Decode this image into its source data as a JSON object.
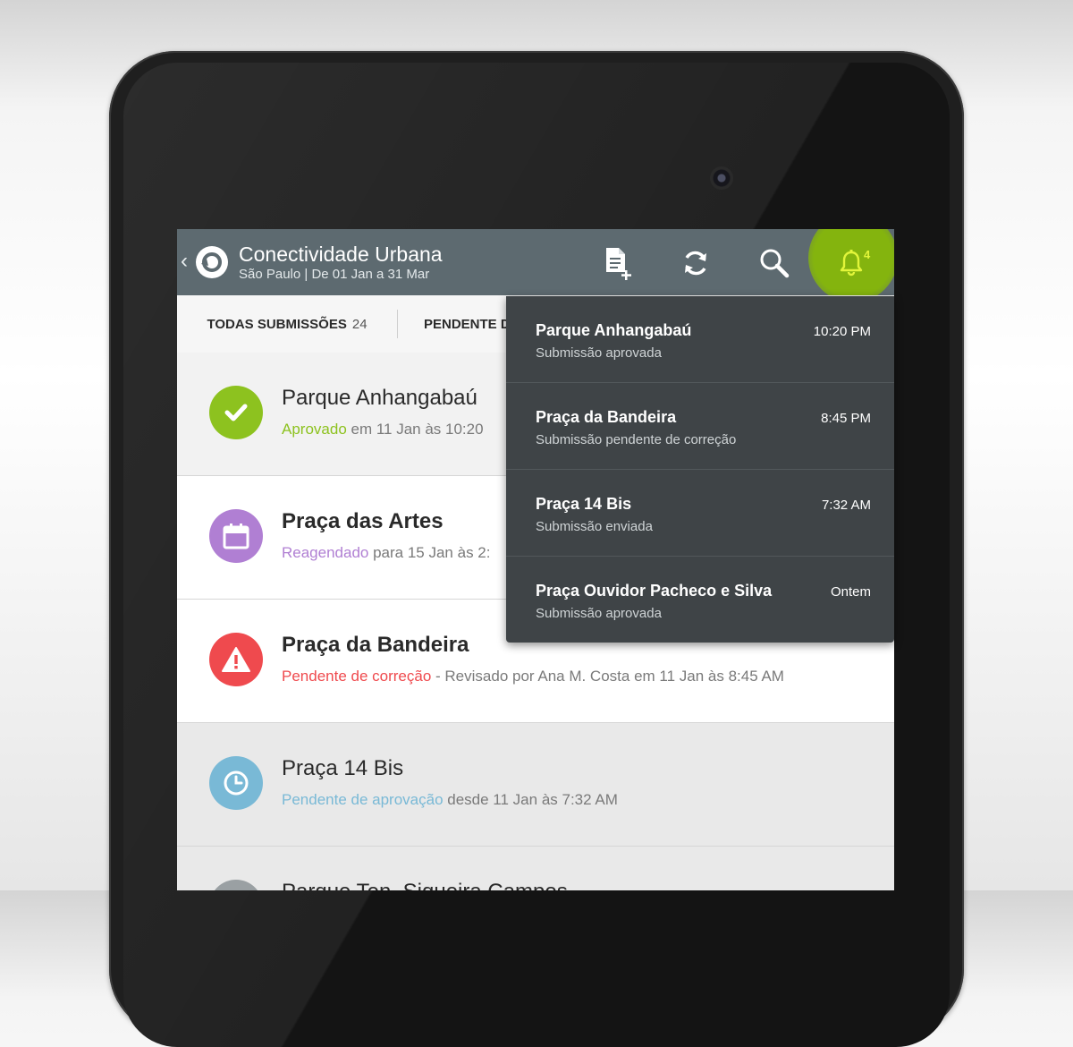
{
  "colors": {
    "appbar": "#5d6a70",
    "approved": "#8dc21f",
    "rescheduled": "#b07fd3",
    "correction": "#ef4a4e",
    "pending_approval": "#79b9d6",
    "notification_accent": "#84b40e",
    "panel": "#3f4447"
  },
  "appbar": {
    "back_icon": "chevron-left-icon",
    "logo_icon": "refresh-circle-logo",
    "title": "Conectividade Urbana",
    "subtitle": "São Paulo | De 01 Jan a 31 Mar",
    "actions": {
      "new_submission_icon": "file-add-icon",
      "sync_icon": "sync-icon",
      "search_icon": "search-icon",
      "notifications_icon": "bell-icon",
      "notifications_count": "4"
    }
  },
  "tabs": [
    {
      "label": "TODAS SUBMISSÕES",
      "count": "24",
      "selected": true
    },
    {
      "label": "PENDENTE D",
      "count": "",
      "selected": false
    }
  ],
  "submissions": [
    {
      "title": "Parque Anhangabaú",
      "status": "Aprovado",
      "detail": " em 11 Jan às 10:20",
      "icon": "check-icon",
      "status_color": "#8dc21f",
      "bold": false
    },
    {
      "title": "Praça das Artes",
      "status": "Reagendado",
      "detail": " para 15 Jan às 2:",
      "icon": "calendar-icon",
      "status_color": "#b07fd3",
      "bold": true
    },
    {
      "title": "Praça da Bandeira",
      "status": "Pendente de correção",
      "detail": " - Revisado por Ana M. Costa em 11 Jan às 8:45 AM",
      "icon": "warning-icon",
      "status_color": "#ef4a4e",
      "bold": true
    },
    {
      "title": "Praça 14 Bis",
      "status": "Pendente de aprovação",
      "detail": " desde 11 Jan às 7:32 AM",
      "icon": "clock-icon",
      "status_color": "#79b9d6",
      "bold": false
    },
    {
      "title": "Parque Ten. Siqueira Campos",
      "status": "",
      "detail": "",
      "icon": "status-icon",
      "status_color": "#9aa0a3",
      "bold": false
    }
  ],
  "notifications": [
    {
      "title": "Parque Anhangabaú",
      "subtitle": "Submissão aprovada",
      "time": "10:20 PM"
    },
    {
      "title": "Praça da Bandeira",
      "subtitle": "Submissão pendente de correção",
      "time": "8:45 PM"
    },
    {
      "title": "Praça 14 Bis",
      "subtitle": "Submissão enviada",
      "time": "7:32 AM"
    },
    {
      "title": "Praça Ouvidor Pacheco e Silva",
      "subtitle": "Submissão aprovada",
      "time": "Ontem"
    }
  ]
}
